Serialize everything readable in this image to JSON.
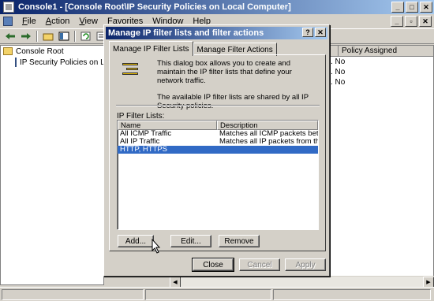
{
  "window": {
    "title": "Console1 - [Console Root\\IP Security Policies on Local Computer]",
    "buttons": [
      "_",
      "□",
      "✕"
    ]
  },
  "menu": {
    "items": [
      {
        "u": "F",
        "rest": "ile"
      },
      {
        "u": "A",
        "rest": "ction"
      },
      {
        "u": "V",
        "rest": "iew"
      },
      {
        "pre": "Favo",
        "u": "r",
        "rest": "ites"
      },
      {
        "u": "W",
        "rest": "indow"
      },
      {
        "u": "H",
        "rest": "elp"
      }
    ],
    "child_buttons": [
      "_",
      "▫",
      "✕"
    ]
  },
  "toolbar": {
    "icons": [
      "back-icon",
      "forward-icon",
      "up-icon",
      "show-tree-icon",
      "refresh-icon",
      "export-icon",
      "help-icon"
    ]
  },
  "tree": {
    "root": "Console Root",
    "child": "IP Security Policies on Local Computer"
  },
  "right_pane": {
    "column": "Policy Assigned",
    "rows": [
      ".  No",
      ".  No",
      ".  No"
    ]
  },
  "dialog": {
    "title": "Manage IP filter lists and filter actions",
    "title_buttons": [
      "?",
      "✕"
    ],
    "tabs": [
      "Manage IP Filter Lists",
      "Manage Filter Actions"
    ],
    "info_line1": "This dialog box allows you to create and maintain the IP filter lists that define your network traffic.",
    "info_line2": "The available IP filter lists are shared by all IP Security policies.",
    "list_label": "IP Filter Lists:",
    "columns": {
      "name": "Name",
      "description": "Description"
    },
    "rows": [
      {
        "name": "All ICMP Traffic",
        "description": "Matches all ICMP packets betw...",
        "selected": false
      },
      {
        "name": "All IP Traffic",
        "description": "Matches all IP packets from this ...",
        "selected": false
      },
      {
        "name": "HTTP, HTTPS",
        "description": "",
        "selected": true
      }
    ],
    "buttons": {
      "add": "Add...",
      "edit": "Edit...",
      "remove": "Remove",
      "close": "Close",
      "cancel": "Cancel",
      "apply": "Apply"
    }
  },
  "colors": {
    "title_start": "#0a246a",
    "title_end": "#a6caf0",
    "selection": "#316ac5",
    "face": "#d4d0c8"
  }
}
